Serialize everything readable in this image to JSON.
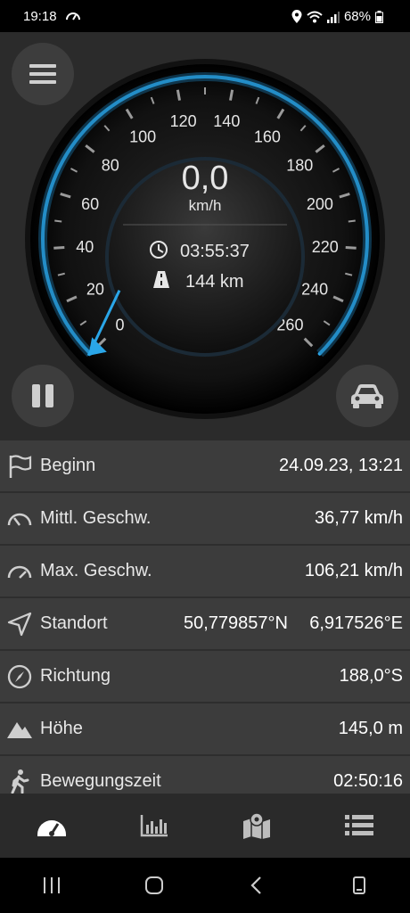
{
  "status": {
    "time": "19:18",
    "battery": "68%"
  },
  "gauge": {
    "speed": "0,0",
    "unit": "km/h",
    "elapsed": "03:55:37",
    "distance": "144 km",
    "ticks": [
      "0",
      "20",
      "40",
      "60",
      "80",
      "100",
      "120",
      "140",
      "160",
      "180",
      "200",
      "220",
      "240",
      "260"
    ],
    "needle_value": 0,
    "max_value": 260
  },
  "rows": [
    {
      "label": "Beginn",
      "value": "24.09.23, 13:21",
      "icon": "flag-icon"
    },
    {
      "label": "Mittl. Geschw.",
      "value": "36,77 km/h",
      "icon": "speedometer-icon"
    },
    {
      "label": "Max. Geschw.",
      "value": "106,21 km/h",
      "icon": "speedometer-icon"
    },
    {
      "label": "Standort",
      "value": "50,779857°N",
      "value2": "6,917526°E",
      "icon": "location-arrow-icon"
    },
    {
      "label": "Richtung",
      "value": "188,0°S",
      "icon": "compass-icon"
    },
    {
      "label": "Höhe",
      "value": "145,0 m",
      "icon": "mountain-icon"
    },
    {
      "label": "Bewegungszeit",
      "value": "02:50:16",
      "icon": "walking-icon"
    }
  ],
  "tabs": [
    "speedometer-icon",
    "chart-icon",
    "map-icon",
    "list-icon"
  ],
  "colors": {
    "accent": "#2aa6e8",
    "background": "#2b2b2b",
    "list_bg": "#3c3c3c"
  }
}
